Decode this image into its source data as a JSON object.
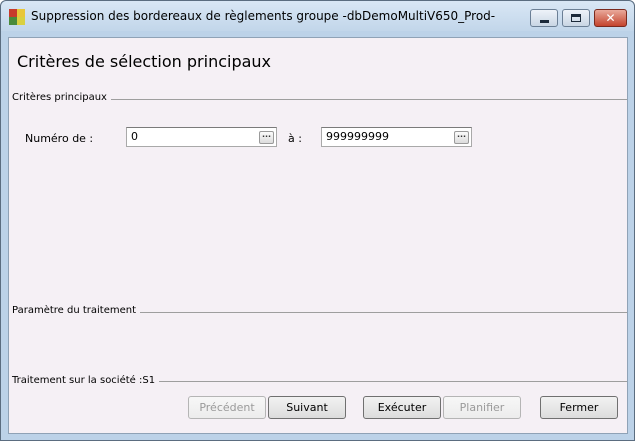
{
  "window": {
    "title": "Suppression des bordereaux de règlements groupe -dbDemoMultiV650_Prod-",
    "minimize_icon": "minimize-icon",
    "maximize_icon": "maximize-icon",
    "close_icon": "close-icon",
    "close_glyph": "✕"
  },
  "page": {
    "heading": "Critères de sélection principaux"
  },
  "criteria": {
    "section_label": "Critères principaux",
    "from_label": "Numéro de :",
    "from_value": "0",
    "to_label": "à :",
    "to_value": "999999999",
    "browse_glyph": "..."
  },
  "processing": {
    "section_label": "Paramètre du traitement"
  },
  "company": {
    "section_label": "Traitement sur la société :S1"
  },
  "buttons": {
    "previous": "Précédent",
    "next": "Suivant",
    "execute": "Exécuter",
    "schedule": "Planifier",
    "close": "Fermer"
  },
  "colors": {
    "client_bg": "#f5f0f5",
    "titlebar": "#c2d6ea",
    "close_button": "#c4442d"
  }
}
